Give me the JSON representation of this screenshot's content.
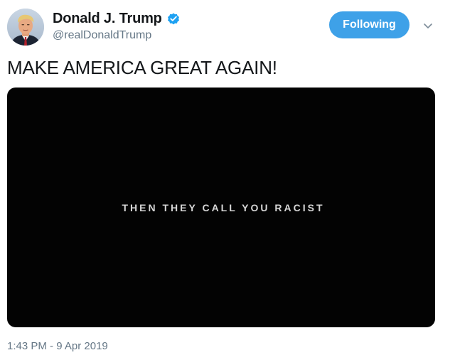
{
  "author": {
    "display_name": "Donald J. Trump",
    "handle": "@realDonaldTrump",
    "verified": true
  },
  "actions": {
    "follow_label": "Following",
    "menu_icon": "chevron-down-icon"
  },
  "tweet": {
    "text": "MAKE AMERICA GREAT AGAIN!",
    "media_caption": "THEN THEY CALL YOU RACIST",
    "timestamp": "1:43 PM - 9 Apr 2019"
  },
  "colors": {
    "accent": "#3ea1e8",
    "verified_badge": "#1da1f2",
    "secondary_text": "#657786",
    "media_background": "#030303"
  }
}
